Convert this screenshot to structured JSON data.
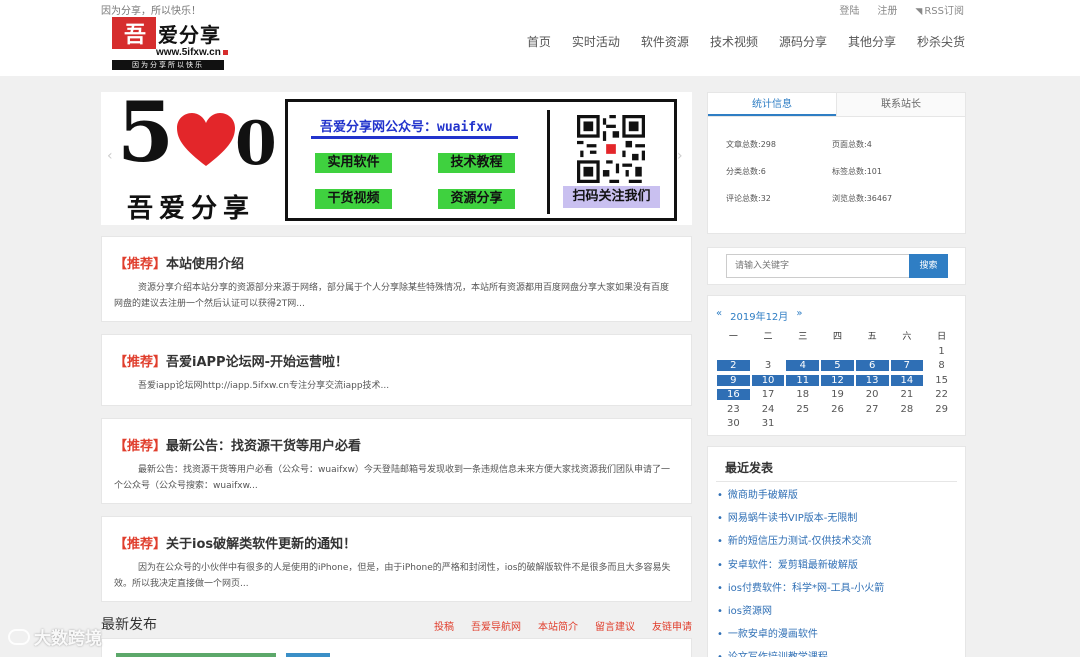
{
  "header": {
    "tagline": "因为分享，所以快乐！",
    "top_links": {
      "login": "登陆",
      "register": "注册",
      "rss": "RSS订阅"
    },
    "logo": {
      "seal": "吾",
      "name": "爱分享",
      "url": "www.5ifxw.cn",
      "slogan": "因为分享所以快乐"
    },
    "nav": [
      "首页",
      "实时活动",
      "软件资源",
      "技术视频",
      "源码分享",
      "其他分享",
      "秒杀尖货"
    ]
  },
  "banner": {
    "num_left": "5",
    "num_right": "0",
    "slogan": "吾爱分享",
    "wechat_title": "吾爱分享网公众号：wuaifxw",
    "buttons": [
      "实用软件",
      "技术教程",
      "干货视频",
      "资源分享"
    ],
    "scan_label": "扫码关注我们",
    "accent": "#3fd13f"
  },
  "posts": [
    {
      "tag": "【推荐】",
      "title": "本站使用介绍",
      "excerpt": "资源分享介绍本站分享的资源部分来源于网络，部分属于个人分享除某些特殊情况，本站所有资源都用百度网盘分享大家如果没有百度网盘的建议去注册一个然后认证可以获得2T网..."
    },
    {
      "tag": "【推荐】",
      "title": "吾爱iAPP论坛网-开始运营啦！",
      "excerpt": "吾爱iapp论坛网http://iapp.5ifxw.cn专注分享交流iapp技术..."
    },
    {
      "tag": "【推荐】",
      "title": "最新公告：找资源干货等用户必看",
      "excerpt": "最新公告：找资源干货等用户必看（公众号：wuaifxw）今天登陆邮箱号发现收到一条违规信息未来方便大家找资源我们团队申请了一个公众号（公众号搜索：wuaifxw..."
    },
    {
      "tag": "【推荐】",
      "title": "关于ios破解类软件更新的通知！",
      "excerpt": "因为在公众号的小伙伴中有很多的人是使用的iPhone，但是，由于iPhone的严格和封闭性，ios的破解版软件不是很多而且大多容易失效。所以我决定直接做一个网页..."
    }
  ],
  "latest": {
    "title": "最新发布",
    "links": [
      "投稿",
      "吾爱导航网",
      "本站简介",
      "留言建议",
      "友链申请"
    ]
  },
  "sidebar": {
    "tabs": [
      "统计信息",
      "联系站长"
    ],
    "stats": [
      "文章总数:298",
      "页面总数:4",
      "分类总数:6",
      "标签总数:101",
      "评论总数:32",
      "浏览总数:36467"
    ],
    "search": {
      "placeholder": "请输入关键字",
      "button": "搜索"
    },
    "calendar": {
      "prev": "«",
      "month": "2019年12月",
      "next": "»",
      "weekdays": [
        "一",
        "二",
        "三",
        "四",
        "五",
        "六",
        "日"
      ],
      "weeks": [
        [
          "",
          "",
          "",
          "",
          "",
          "",
          "1"
        ],
        [
          "2",
          "3",
          "4",
          "5",
          "6",
          "7",
          "8"
        ],
        [
          "9",
          "10",
          "11",
          "12",
          "13",
          "14",
          "15"
        ],
        [
          "16",
          "17",
          "18",
          "19",
          "20",
          "21",
          "22"
        ],
        [
          "23",
          "24",
          "25",
          "26",
          "27",
          "28",
          "29"
        ],
        [
          "30",
          "31",
          "",
          "",
          "",
          "",
          ""
        ]
      ],
      "linked_days": [
        "2",
        "4",
        "5",
        "6",
        "7",
        "9",
        "10",
        "11",
        "12",
        "13",
        "14",
        "16"
      ]
    },
    "recent_title": "最近发表",
    "recent": [
      "微商助手破解版",
      "网易蜗牛读书VIP版本-无限制",
      "新的短信压力测试-仅供技术交流",
      "安卓软件：爱剪辑最新破解版",
      "ios付费软件：科学*网-工具-小火箭",
      "ios资源网",
      "一款安卓的漫画软件",
      "论文写作培训教学课程"
    ]
  },
  "watermark": "大数跨境"
}
